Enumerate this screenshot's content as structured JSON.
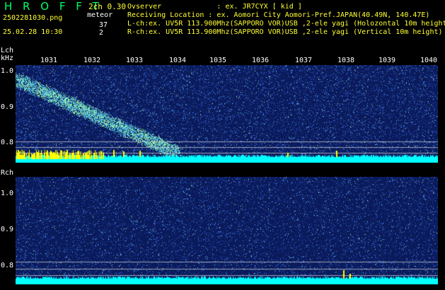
{
  "header": {
    "app_title": "H R O F F T",
    "mode": "2ch 0.30",
    "meteor_label": "meteor",
    "lch_count": "37",
    "rch_count": "2",
    "filename": "2502281030.png",
    "datetime": "25.02.28 10:30",
    "observer_line": "Ovserver             : ex. JR7CYX [ kid ]",
    "location_line": "Receiving Location : ex. Aomori City Aomori-Pref.JAPAN(40.49N, 140.47E)",
    "lch_info": "L-ch:ex. UV5R 113.900Mhz(SAPPORO VOR)USB ,2-ele yagi (Holozontal 10m height",
    "rch_info": "R-ch:ex. UV5R 113.900Mhz(SAPPORO VOR)USB ,2-ele yagi (Vertical 10m height)"
  },
  "lch": {
    "channel_label": "Lch",
    "unit_label": "kHz",
    "y_ticks": [
      "1.0",
      "0.9",
      "0.8"
    ],
    "time_ticks": [
      "1031",
      "1032",
      "1033",
      "1034",
      "1035",
      "1036",
      "1037",
      "1038",
      "1039",
      "1040"
    ]
  },
  "rch": {
    "channel_label": "Rch",
    "y_ticks": [
      "1.0",
      "0.9",
      "0.8"
    ]
  },
  "colors": {
    "background": "#000000",
    "text_primary": "#ffff33",
    "text_secondary": "#ffffff",
    "title": "#00ff66",
    "waterfall_base": "#0a1a5a",
    "noise_floor": "#00ffff",
    "meteor_echo": "#ffff00"
  }
}
